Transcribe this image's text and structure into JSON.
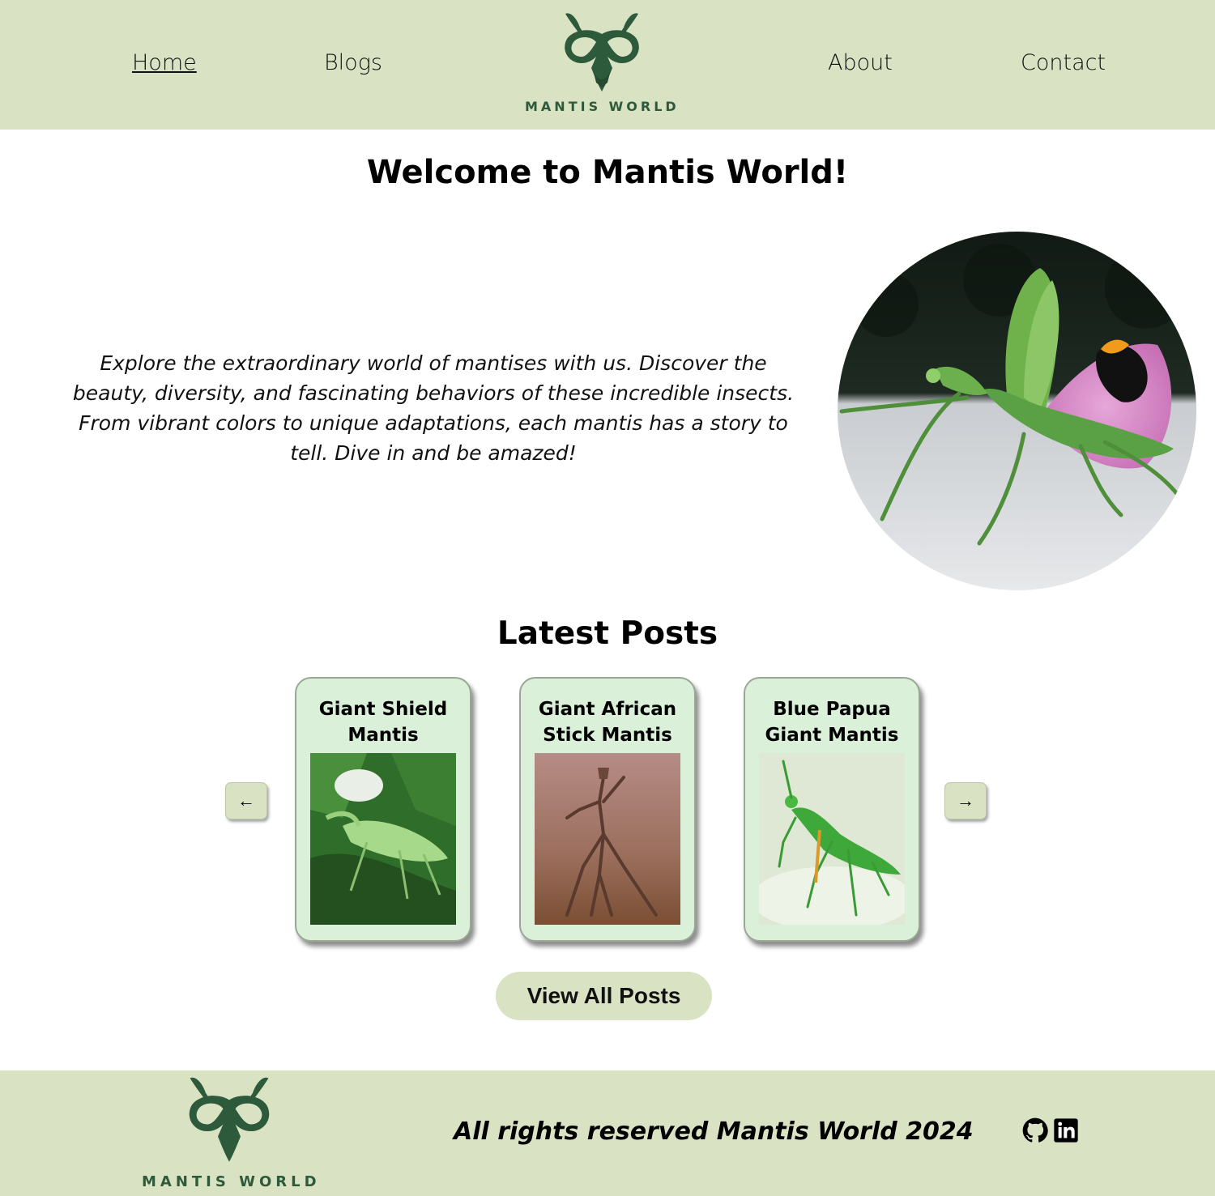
{
  "nav": {
    "home": "Home",
    "blogs": "Blogs",
    "about": "About",
    "contact": "Contact"
  },
  "brand": {
    "name": "MANTIS WORLD",
    "color": "#2d5a3a"
  },
  "welcome": {
    "title": "Welcome to Mantis World!",
    "intro": "Explore the extraordinary world of mantises with us. Discover the beauty, diversity, and fascinating behaviors of these incredible insects. From vibrant colors to unique adaptations, each mantis has a story to tell. Dive in and be amazed!"
  },
  "posts": {
    "title": "Latest Posts",
    "prev_label": "←",
    "next_label": "→",
    "items": [
      {
        "title": "Giant Shield Mantis"
      },
      {
        "title": "Giant African Stick Mantis"
      },
      {
        "title": "Blue Papua Giant Mantis"
      }
    ],
    "view_all_label": "View All Posts"
  },
  "footer": {
    "copyright": "All rights reserved Mantis World 2024",
    "social_icons": [
      "github-icon",
      "linkedin-icon"
    ]
  },
  "colors": {
    "header_bg": "#d9e3c4",
    "card_bg": "#dbf0d8",
    "brand_green": "#2d5a3a"
  }
}
